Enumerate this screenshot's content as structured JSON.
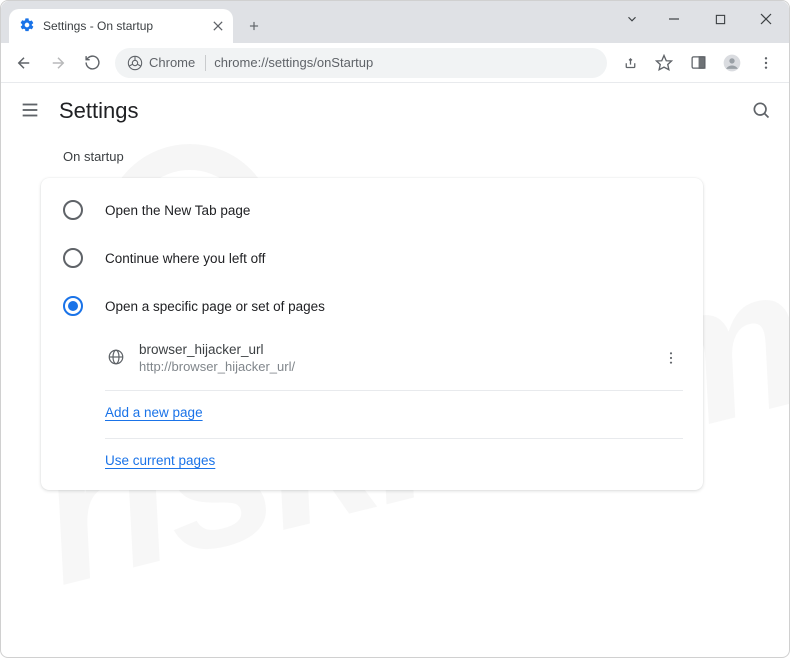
{
  "tab": {
    "title": "Settings - On startup"
  },
  "omnibox": {
    "origin_label": "Chrome",
    "url": "chrome://settings/onStartup"
  },
  "page": {
    "title": "Settings"
  },
  "startup": {
    "section_label": "On startup",
    "options": {
      "newtab": "Open the New Tab page",
      "continue": "Continue where you left off",
      "specific": "Open a specific page or set of pages"
    },
    "pages": [
      {
        "name": "browser_hijacker_url",
        "url": "http://browser_hijacker_url/"
      }
    ],
    "add_link": "Add a new page",
    "use_current_link": "Use current pages"
  }
}
